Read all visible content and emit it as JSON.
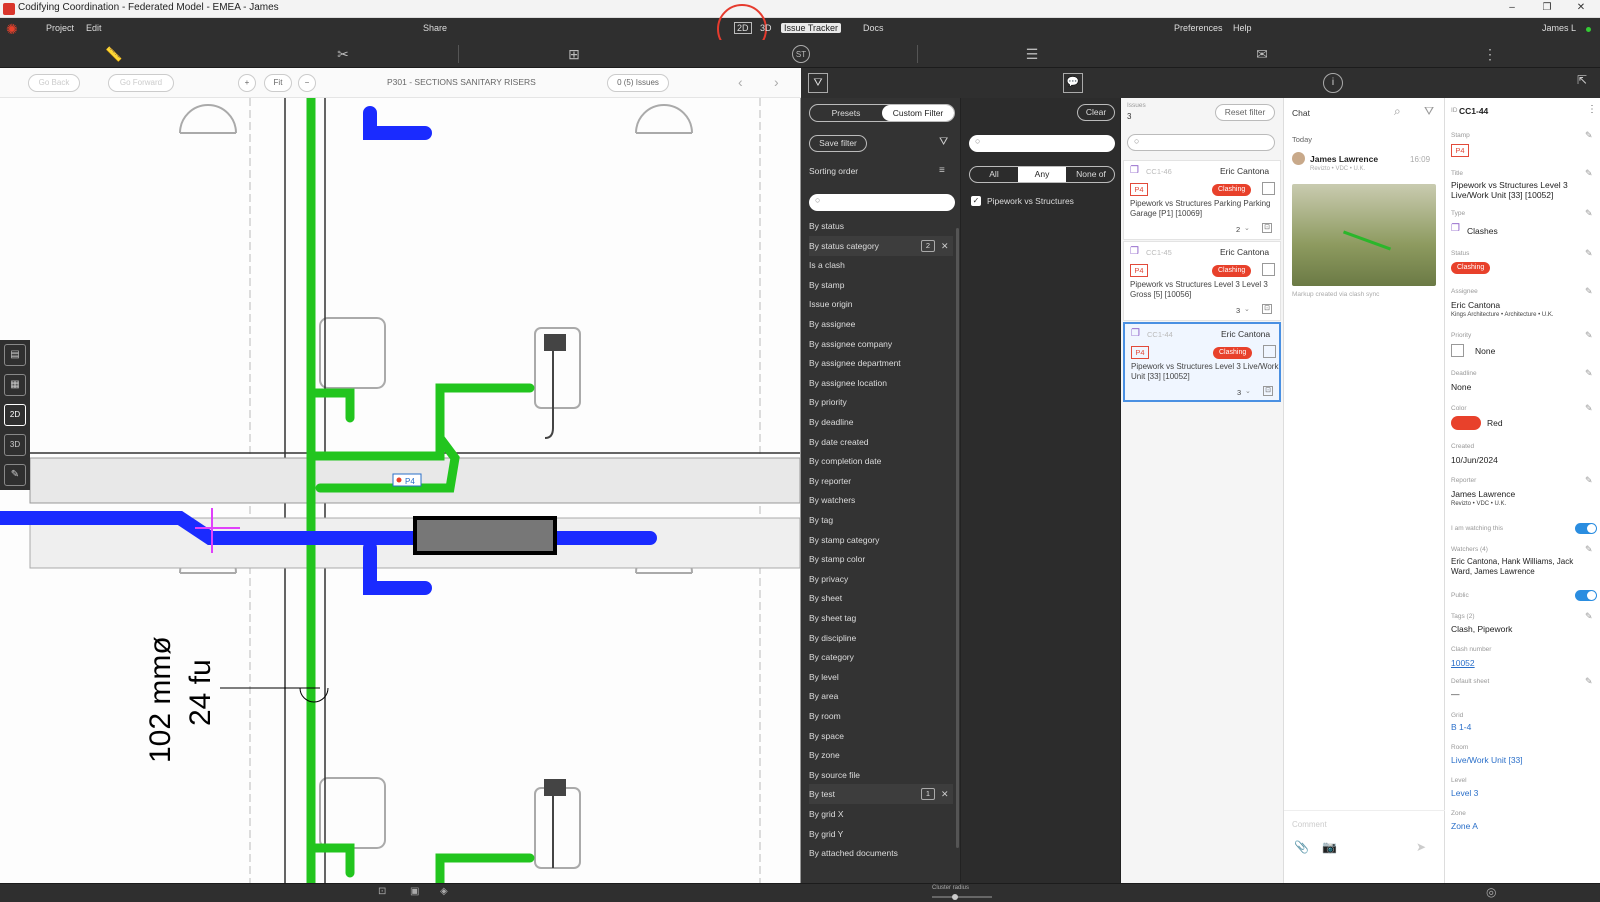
{
  "window": {
    "title": "Codifying Coordination - Federated Model - EMEA - James"
  },
  "menu": {
    "items": [
      "Project",
      "Edit",
      "Share",
      "2D",
      "3D",
      "Issue Tracker",
      "Docs",
      "Preferences",
      "Help"
    ],
    "user": "James L"
  },
  "canvas": {
    "back_label": "Go Back",
    "forward_label": "Go Forward",
    "fit_label": "Fit",
    "sheet_title": "P301 - SECTIONS SANITARY RISERS",
    "issues_label": "0 (5) Issues",
    "dim_text_1": "102 mmø",
    "dim_text_2": "24 fu",
    "marker_label": "P4"
  },
  "left_tools": {
    "items": [
      "2D",
      "3D"
    ]
  },
  "filter": {
    "tabs": [
      "Presets",
      "Custom Filter"
    ],
    "save_label": "Save filter",
    "sorting_label": "Sorting order",
    "items": [
      {
        "label": "By status"
      },
      {
        "label": "By status category",
        "count": "2"
      },
      {
        "label": "Is a clash"
      },
      {
        "label": "By stamp"
      },
      {
        "label": "Issue origin"
      },
      {
        "label": "By assignee"
      },
      {
        "label": "By assignee company"
      },
      {
        "label": "By assignee department"
      },
      {
        "label": "By assignee location"
      },
      {
        "label": "By priority"
      },
      {
        "label": "By deadline"
      },
      {
        "label": "By date created"
      },
      {
        "label": "By completion date"
      },
      {
        "label": "By reporter"
      },
      {
        "label": "By watchers"
      },
      {
        "label": "By tag"
      },
      {
        "label": "By stamp category"
      },
      {
        "label": "By stamp color"
      },
      {
        "label": "By privacy"
      },
      {
        "label": "By sheet"
      },
      {
        "label": "By sheet tag"
      },
      {
        "label": "By discipline"
      },
      {
        "label": "By category"
      },
      {
        "label": "By level"
      },
      {
        "label": "By area"
      },
      {
        "label": "By room"
      },
      {
        "label": "By space"
      },
      {
        "label": "By zone"
      },
      {
        "label": "By source file"
      },
      {
        "label": "By test",
        "count": "1"
      },
      {
        "label": "By grid X"
      },
      {
        "label": "By grid Y"
      },
      {
        "label": "By attached documents"
      }
    ]
  },
  "any_panel": {
    "clear_label": "Clear",
    "modes": [
      "All",
      "Any",
      "None of"
    ],
    "option": "Pipework vs Structures"
  },
  "issues": {
    "count_label": "Issues",
    "count": "3",
    "reset_label": "Reset filter",
    "list": [
      {
        "id": "CC1-46",
        "assignee": "Eric Cantona",
        "stamp": "P4",
        "status": "Clashing",
        "title": "Pipework vs Structures Parking Parking Garage [P1] [10069]",
        "count": "2"
      },
      {
        "id": "CC1-45",
        "assignee": "Eric Cantona",
        "stamp": "P4",
        "status": "Clashing",
        "title": "Pipework vs Structures Level 3 Level 3 Gross [5] [10056]",
        "count": "3"
      },
      {
        "id": "CC1-44",
        "assignee": "Eric Cantona",
        "stamp": "P4",
        "status": "Clashing",
        "title": "Pipework vs Structures Level 3 Live/Work Unit [33] [10052]",
        "count": "3"
      }
    ]
  },
  "chat": {
    "title": "Chat",
    "day": "Today",
    "author": "James Lawrence",
    "time": "16:09",
    "org": "Revizto • VDC • U.K.",
    "caption": "Markup created via clash sync",
    "comment_placeholder": "Comment"
  },
  "detail": {
    "id": "CC1-44",
    "stamp_label": "Stamp",
    "stamp": "P4",
    "title_label": "Title",
    "title": "Pipework vs Structures Level 3 Live/Work Unit [33] [10052]",
    "type_label": "Type",
    "type": "Clashes",
    "status_label": "Status",
    "status": "Clashing",
    "assignee_label": "Assignee",
    "assignee": "Eric Cantona",
    "assignee_org": "Kings Architecture • Architecture • U.K.",
    "priority_label": "Priority",
    "priority": "None",
    "deadline_label": "Deadline",
    "deadline": "None",
    "color_label": "Color",
    "color": "Red",
    "color_hex": "#e8412b",
    "created_label": "Created",
    "created": "10/Jun/2024",
    "reporter_label": "Reporter",
    "reporter": "James Lawrence",
    "reporter_org": "Revizto • VDC • U.K.",
    "watching_label": "I am watching this",
    "watchers_label": "Watchers (4)",
    "watchers": "Eric Cantona, Hank Williams, Jack Ward, James Lawrence",
    "public_label": "Public",
    "tags_label": "Tags (2)",
    "tags": "Clash, Pipework",
    "clash_label": "Clash number",
    "clash": "10052",
    "sheet_label": "Default sheet",
    "sheet": "—",
    "grid_label": "Grid",
    "grid": "B 1-4",
    "room_label": "Room",
    "room": "Live/Work Unit [33]",
    "level_label": "Level",
    "level": "Level 3",
    "zone_label": "Zone",
    "zone": "Zone A"
  },
  "bottom": {
    "cluster_label": "Cluster radius"
  },
  "colors": {
    "accent": "#e8412b",
    "pipe_green": "#22c51e",
    "pipe_blue": "#1a2bff",
    "panel": "#333333"
  }
}
